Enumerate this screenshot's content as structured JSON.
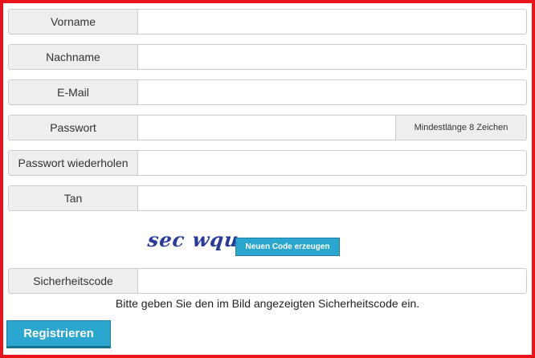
{
  "form": {
    "first_name": {
      "label": "Vorname",
      "value": ""
    },
    "last_name": {
      "label": "Nachname",
      "value": ""
    },
    "email": {
      "label": "E-Mail",
      "value": ""
    },
    "password": {
      "label": "Passwort",
      "value": "",
      "hint": "Mindestlänge 8 Zeichen"
    },
    "password_repeat": {
      "label": "Passwort wiederholen",
      "value": ""
    },
    "tan": {
      "label": "Tan",
      "value": ""
    },
    "captcha": {
      "image_text": "sec wqu",
      "refresh_label": "Neuen Code erzeugen"
    },
    "security_code": {
      "label": "Sicherheitscode",
      "value": ""
    },
    "security_hint": "Bitte geben Sie den im Bild angezeigten Sicherheitscode ein.",
    "submit_label": "Registrieren"
  },
  "colors": {
    "frame_border": "#e8141b",
    "button": "#2aa6cf",
    "captcha_text": "#2a3a9a"
  }
}
